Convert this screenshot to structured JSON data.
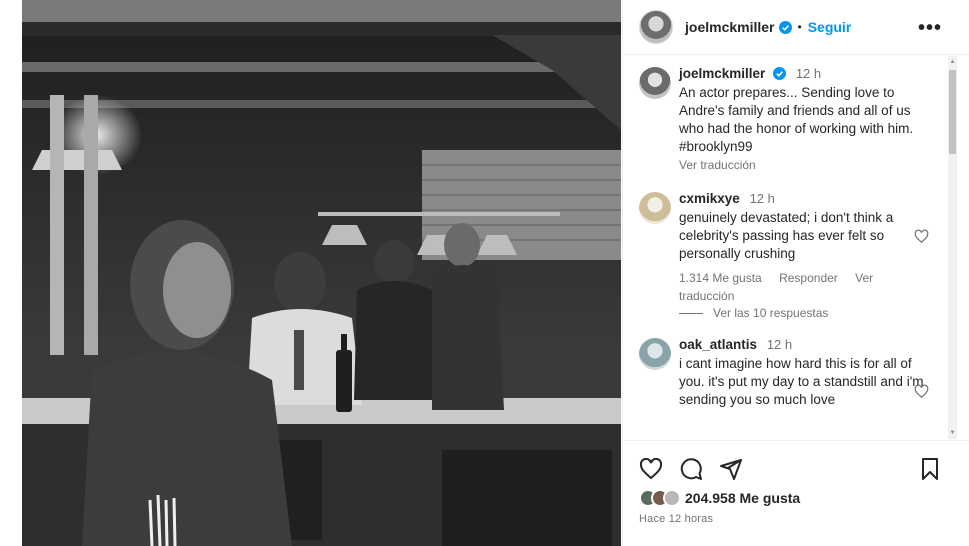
{
  "post": {
    "author": "joelmckmiller",
    "follow_label": "Seguir",
    "separator": "•",
    "more_label": "•••"
  },
  "caption": {
    "username": "joelmckmiller",
    "time": "12 h",
    "text": "An actor prepares... Sending love to Andre's family and friends and all of us who had the honor of working with him. #brooklyn99",
    "translate_label": "Ver traducción"
  },
  "comments": [
    {
      "username": "cxmikxye",
      "time": "12 h",
      "text": "genuinely devastated; i don't think a celebrity's passing has ever felt so personally crushing",
      "likes_label": "1.314 Me gusta",
      "reply_label": "Responder",
      "translate_label": "Ver traducción"
    },
    {
      "username": "oak_atlantis",
      "time": "12 h",
      "text": "i cant imagine how hard this is for all of you. it's put my day to a standstill and i'm sending you so much love"
    }
  ],
  "replies_toggle": "Ver las 10 respuestas",
  "footer": {
    "likes": "204.958 Me gusta",
    "time_ago": "Hace 12 horas"
  },
  "colors": {
    "accent": "#0095f6",
    "verified": "#0095f6",
    "muted": "#737373",
    "divider": "#efefef"
  },
  "icons": [
    "verified-icon",
    "more-icon",
    "heart-icon",
    "comment-icon",
    "share-icon",
    "bookmark-icon"
  ]
}
